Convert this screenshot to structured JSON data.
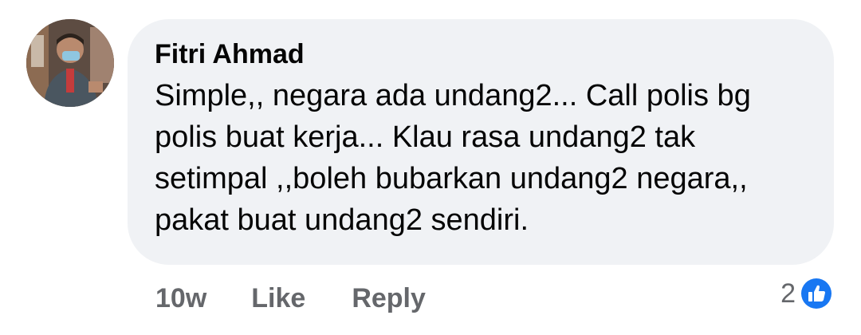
{
  "comment": {
    "author": "Fitri Ahmad",
    "text": "Simple,, negara ada undang2... Call polis bg polis buat kerja... Klau rasa undang2 tak setimpal ,,boleh bubarkan undang2 negara,, pakat buat undang2 sendiri.",
    "timestamp": "10w",
    "like_label": "Like",
    "reply_label": "Reply",
    "reaction_count": "2",
    "reaction_icon": "like-thumb-icon"
  },
  "colors": {
    "bubble_bg": "#f0f2f5",
    "meta_text": "#65676b",
    "like_blue": "#1877f2"
  }
}
